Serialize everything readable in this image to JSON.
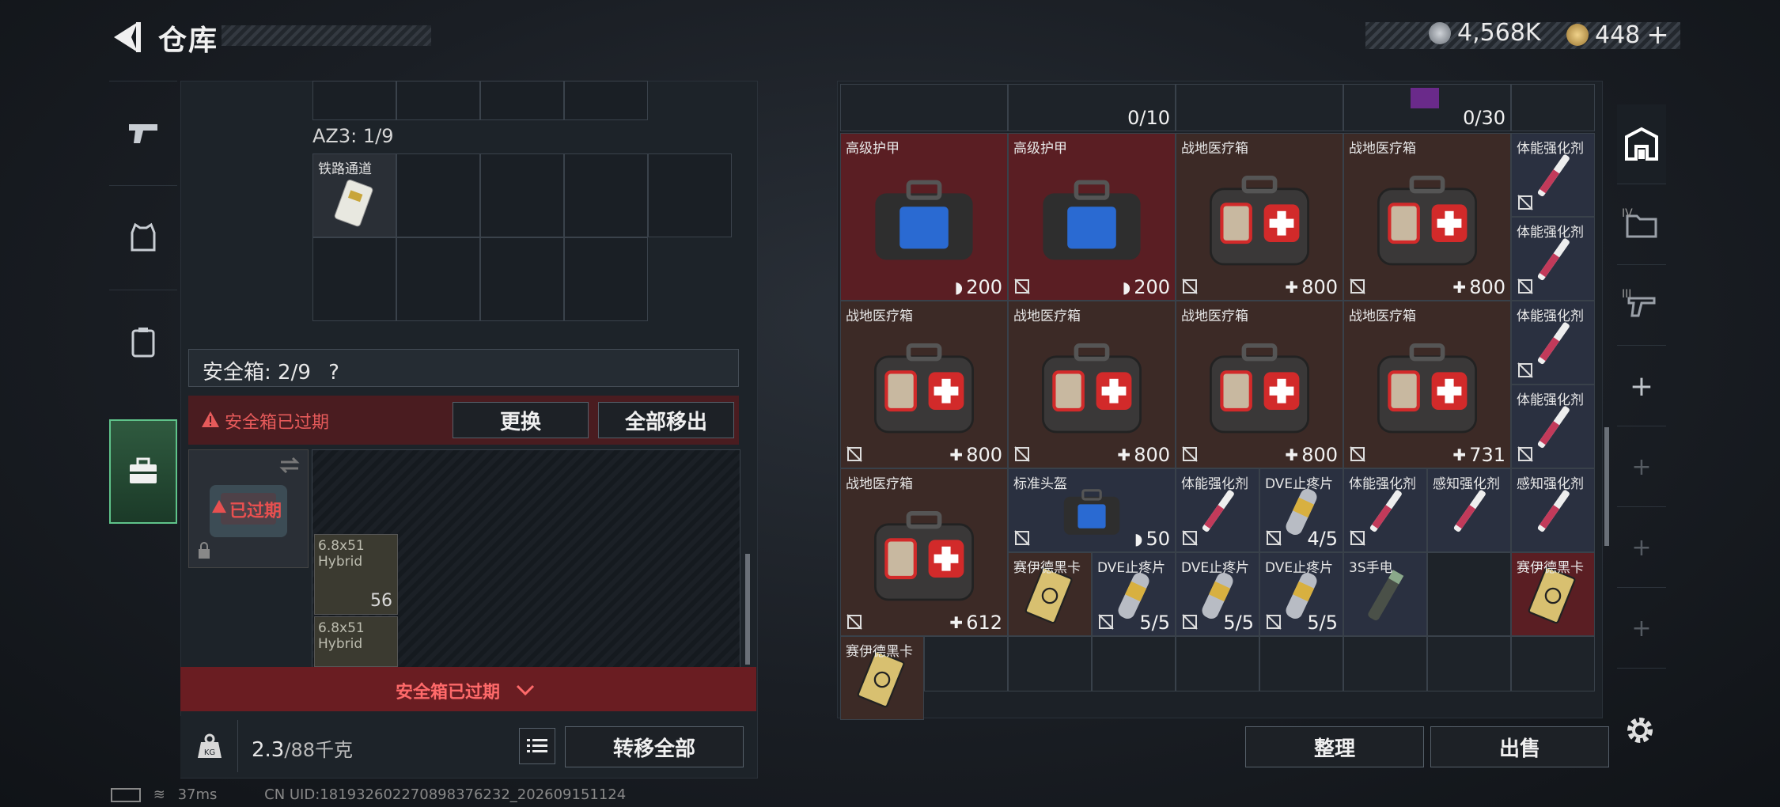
{
  "header": {
    "title": "仓库",
    "currency1": "4,568K",
    "currency2": "448",
    "add_symbol": "+"
  },
  "left_panel": {
    "az3_label": "AZ3: 1/9",
    "rail_item": "铁路通道",
    "safe_label": "安全箱: 2/9",
    "help_symbol": "?",
    "warning": "安全箱已过期",
    "swap_button": "更换",
    "move_all_button": "全部移出",
    "expired_badge": "已过期",
    "ammo": [
      {
        "name": "6.8x51",
        "sub": "Hybrid",
        "qty": "56"
      },
      {
        "name": "6.8x51",
        "sub": "Hybrid",
        "qty": ""
      }
    ],
    "expired_banner": "安全箱已过期",
    "weight": "2.3",
    "weight_max": "/88千克",
    "transfer_all_button": "转移全部"
  },
  "right_panel": {
    "top_row": {
      "count1": "0/10",
      "count2": "0/30"
    },
    "items": [
      {
        "name": "高级护甲",
        "value": "200",
        "type": "armor"
      },
      {
        "name": "高级护甲",
        "value": "200",
        "type": "armor"
      },
      {
        "name": "战地医疗箱",
        "value": "800",
        "type": "heal"
      },
      {
        "name": "战地医疗箱",
        "value": "800",
        "type": "heal"
      },
      {
        "name": "体能强化剂",
        "value": "",
        "type": "syringe"
      },
      {
        "name": "体能强化剂",
        "value": "",
        "type": "syringe"
      },
      {
        "name": "战地医疗箱",
        "value": "800",
        "type": "heal"
      },
      {
        "name": "战地医疗箱",
        "value": "800",
        "type": "heal"
      },
      {
        "name": "战地医疗箱",
        "value": "800",
        "type": "heal"
      },
      {
        "name": "战地医疗箱",
        "value": "731",
        "type": "heal"
      },
      {
        "name": "体能强化剂",
        "value": "",
        "type": "syringe"
      },
      {
        "name": "体能强化剂",
        "value": "",
        "type": "syringe"
      },
      {
        "name": "战地医疗箱",
        "value": "612",
        "type": "heal"
      },
      {
        "name": "标准头盔",
        "value": "50",
        "type": "armor"
      },
      {
        "name": "体能强化剂",
        "value": "",
        "type": "syringe"
      },
      {
        "name": "DVE止疼片",
        "value": "4/5",
        "type": "pill"
      },
      {
        "name": "体能强化剂",
        "value": "",
        "type": "syringe"
      },
      {
        "name": "感知强化剂",
        "value": "",
        "type": "syringe"
      },
      {
        "name": "感知强化剂",
        "value": "",
        "type": "syringe"
      },
      {
        "name": "赛伊德黑卡",
        "value": "",
        "type": "card"
      },
      {
        "name": "DVE止疼片",
        "value": "5/5",
        "type": "pill"
      },
      {
        "name": "DVE止疼片",
        "value": "5/5",
        "type": "pill"
      },
      {
        "name": "DVE止疼片",
        "value": "5/5",
        "type": "pill"
      },
      {
        "name": "3S手电",
        "value": "",
        "type": "torch"
      },
      {
        "name": "赛伊德黑卡",
        "value": "",
        "type": "card"
      },
      {
        "name": "赛伊德黑卡",
        "value": "",
        "type": "card"
      }
    ],
    "sort_button": "整理",
    "sell_button": "出售"
  },
  "right_sidebar": {
    "tab_iv": "IV",
    "tab_iii": "III",
    "add_symbols": [
      "+",
      "+",
      "+",
      "+"
    ]
  },
  "status": {
    "ping": "37ms",
    "uid": "CN UID:181932602270898376232_202609151124"
  },
  "colors": {
    "heal_accent": "#d22a2a",
    "warning_red": "#e65a5a",
    "active_tab": "#5fc38a"
  }
}
